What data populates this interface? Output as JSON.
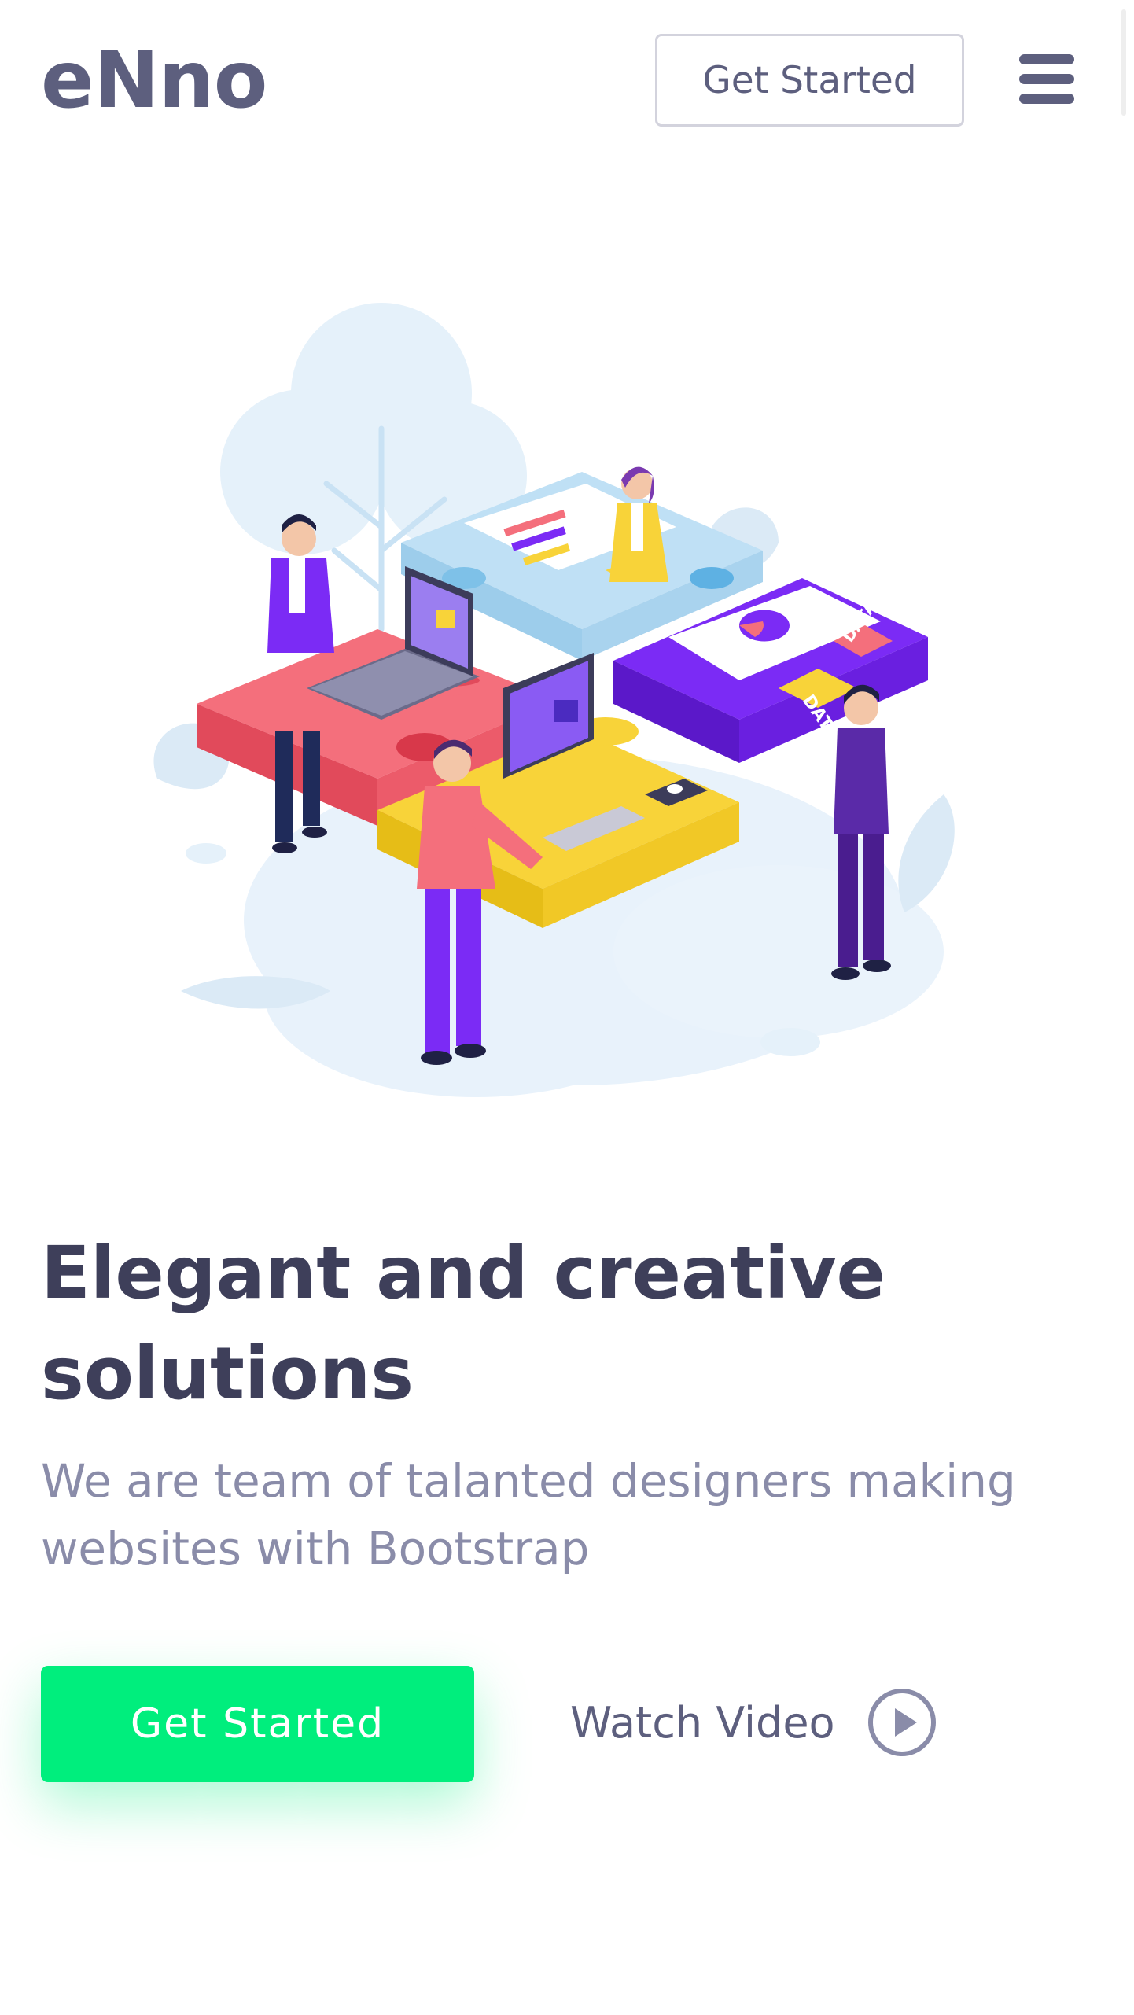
{
  "header": {
    "logo": "eNno",
    "cta_label": "Get Started",
    "menu_icon": "hamburger-menu-icon"
  },
  "hero": {
    "illustration": "team-assembling-puzzle-illustration",
    "puzzle_tag_front": "DATA",
    "puzzle_tag_back": "DATA",
    "title": "Elegant and creative solutions",
    "subtitle": "We are team of talanted designers making websites with Bootstrap",
    "primary_button_label": "Get Started",
    "video_link_label": "Watch Video",
    "video_icon": "play-circle-icon"
  },
  "colors": {
    "accent": "#00ee7d",
    "heading": "#3e3f5a",
    "body_text": "#8a8ca9",
    "nav_text": "#5d5f7e",
    "illustration_backdrop": "#e5f1fa",
    "puzzle_red": "#f46f7c",
    "puzzle_blue": "#bfe0f5",
    "puzzle_yellow": "#f8d339",
    "puzzle_purple": "#7b2bf5"
  }
}
